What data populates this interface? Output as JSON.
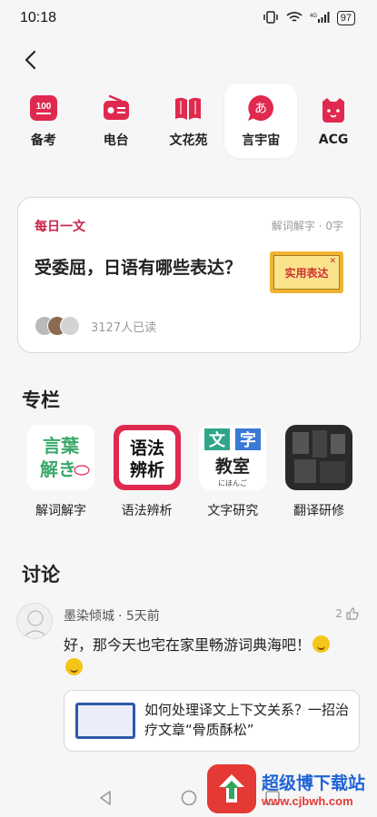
{
  "status": {
    "time": "10:18",
    "battery": "97"
  },
  "categories": [
    {
      "label": "备考",
      "icon": "exam-100-icon"
    },
    {
      "label": "电台",
      "icon": "radio-icon"
    },
    {
      "label": "文花苑",
      "icon": "book-icon"
    },
    {
      "label": "言宇宙",
      "icon": "speech-a-icon",
      "active": true
    },
    {
      "label": "ACG",
      "icon": "cat-face-icon"
    }
  ],
  "daily": {
    "tag": "每日一文",
    "meta": "解词解字 · 0字",
    "title": "受委屈，日语有哪些表达？",
    "thumb_text": "实用表达",
    "read_count": "3127人已读"
  },
  "columns": {
    "title": "专栏",
    "items": [
      {
        "label": "解词解字",
        "img_text": [
          "言葉",
          "解き"
        ]
      },
      {
        "label": "语法辨析",
        "img_text": [
          "语法",
          "辨析"
        ]
      },
      {
        "label": "文字研究",
        "img_text": [
          "文字",
          "教室",
          "にほんご"
        ]
      },
      {
        "label": "翻译研修",
        "img_text": []
      }
    ]
  },
  "discussion": {
    "title": "讨论",
    "comment": {
      "user": "墨染倾城",
      "time": "· 5天前",
      "likes": "2",
      "body": "好，那今天也宅在家里畅游词典海吧！",
      "link_title": "如何处理译文上下文关系？一招治疗文章“骨质酥松”"
    }
  },
  "watermark": {
    "title": "超级博下载站",
    "url": "www.cjbwh.com"
  },
  "colors": {
    "accent": "#c8264a",
    "icon_red": "#e0294f",
    "background": "#f6f6f6"
  }
}
